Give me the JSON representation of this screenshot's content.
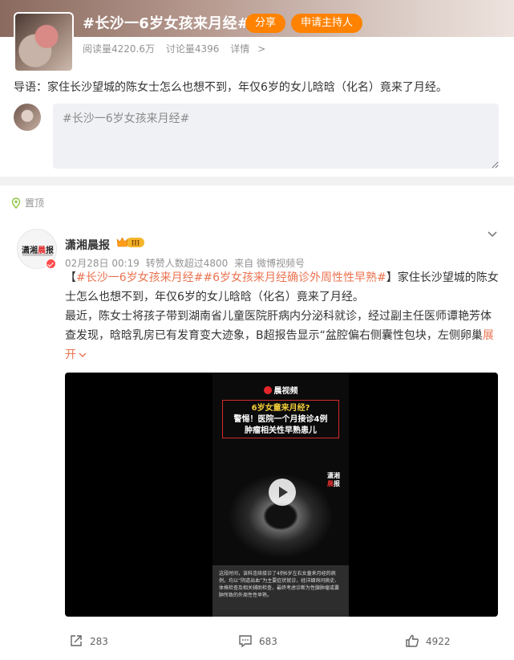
{
  "topic": {
    "title": "#长沙一6岁女孩来月经#",
    "share_label": "分享",
    "host_label": "申请主持人",
    "read_count": "阅读量4220.6万",
    "discuss_count": "讨论量4396",
    "details_label": "详情",
    "intro": "导语：家住长沙望城的陈女士怎么也想不到，年仅6岁的女儿晗晗（化名）竟来了月经。",
    "composer_text": "#长沙一6岁女孩来月经#"
  },
  "post": {
    "pinned_label": "置顶",
    "author": "潇湘晨报",
    "vip_level": "III",
    "avatar_logo_a": "潇湘",
    "avatar_logo_b": "晨",
    "avatar_logo_c": "报",
    "date": "02月28日 00:19",
    "likes_meta": "转赞人数超过4800",
    "source": "来自 微博视频号",
    "bracket_open": "【",
    "tag1": "#长沙一6岁女孩来月经#",
    "tag2": "#6岁女孩来月经确诊外周性性早熟#",
    "bracket_rest": "】家住长沙望城的陈女士怎么也想不到，年仅6岁的女儿晗晗（化名）竟来了月经。",
    "body": "最近，陈女士将孩子带到湖南省儿童医院肝病内分泌科就诊，经过副主任医师谭艳芳体查发现，晗晗乳房已有发育变大迹象，B超报告显示“盆腔偏右侧囊性包块，左侧卵巢",
    "expand_label": "展开",
    "video": {
      "brand": "晨视频",
      "headline_1": "6岁女童来月经?",
      "headline_2": "警惕！医院一个月接诊4例",
      "headline_3": "肿瘤相关性早熟患儿",
      "watermark_1": "潇湘",
      "watermark_2": "晨",
      "watermark_3": "报",
      "caption": "这段时间，该科连续接诊了4例6岁左右女童来月经的病例，均以“阴道出血”为主要症状就诊，经详细询问病史、体格检查及相关辅助检查，最终考虑诊断为性腺肿瘤或囊肿所致的外周性性早熟。"
    },
    "repost_count": "283",
    "comment_count": "683",
    "like_count": "4922"
  },
  "colors": {
    "accent": "#ff8200",
    "link": "#eb7350",
    "composer_bg": "#f0f1f4"
  }
}
